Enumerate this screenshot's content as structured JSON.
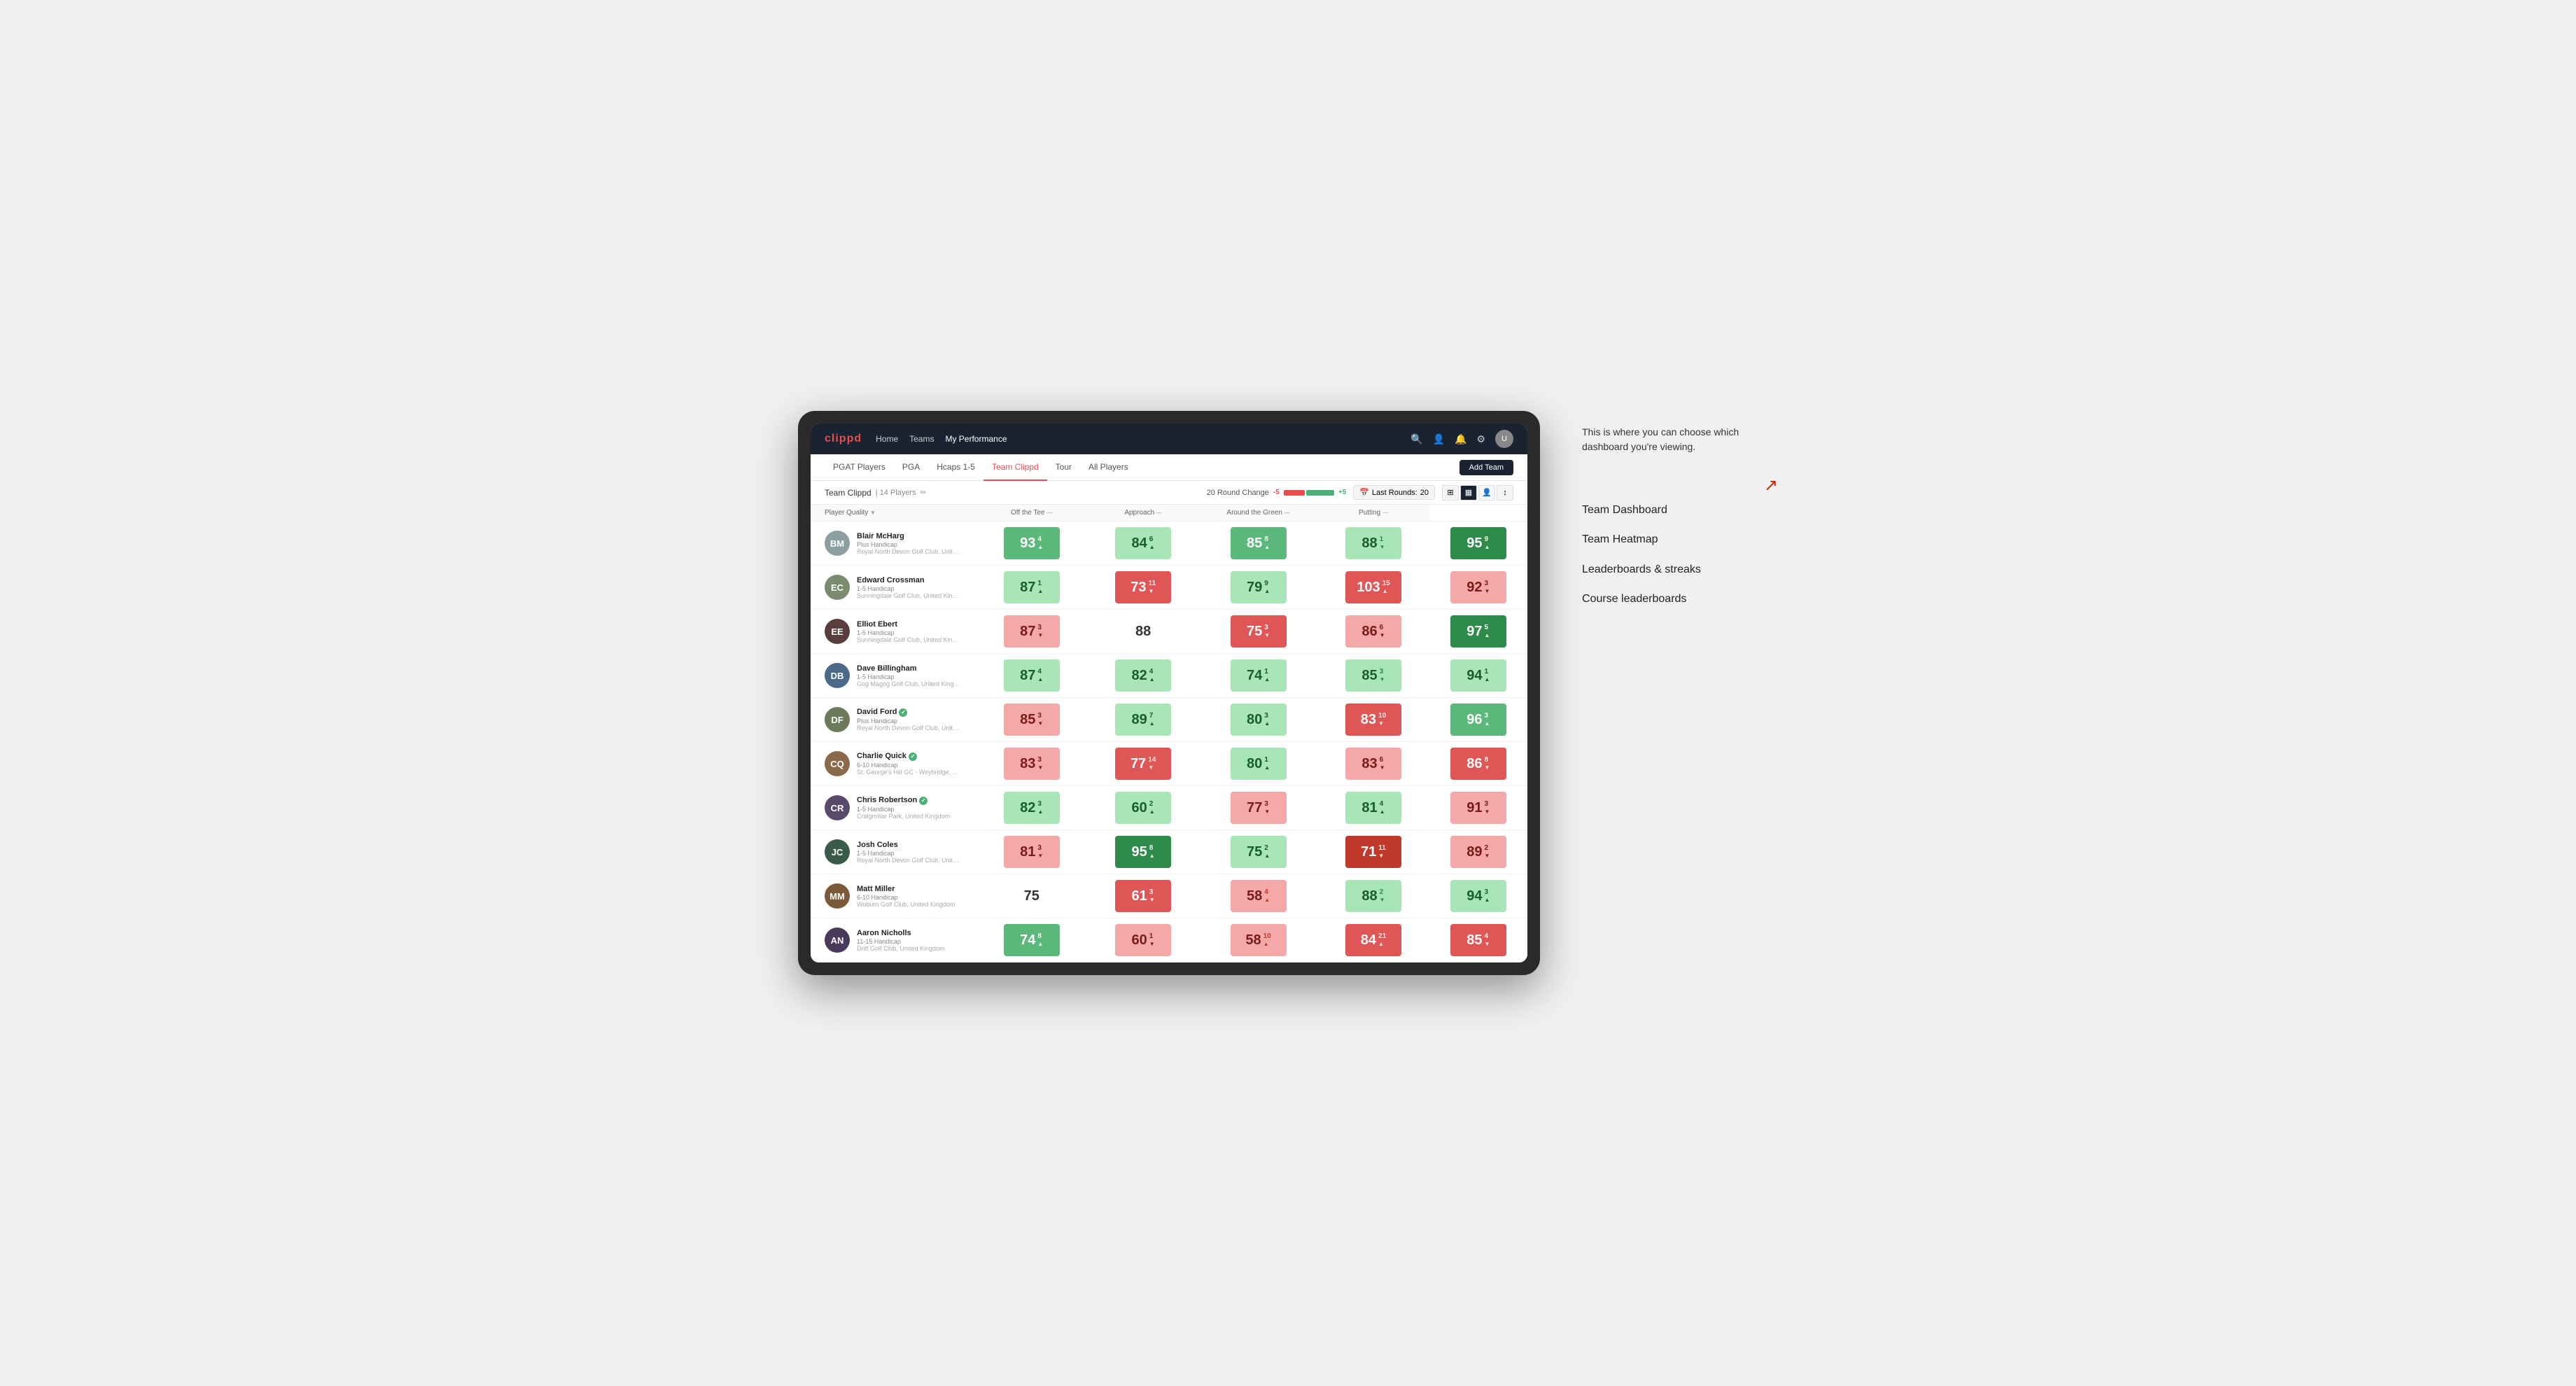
{
  "annotation": {
    "intro": "This is where you can choose which dashboard you're viewing.",
    "items": [
      "Team Dashboard",
      "Team Heatmap",
      "Leaderboards & streaks",
      "Course leaderboards"
    ]
  },
  "nav": {
    "logo": "clippd",
    "links": [
      "Home",
      "Teams",
      "My Performance"
    ],
    "activeLink": "My Performance"
  },
  "subNav": {
    "items": [
      "PGAT Players",
      "PGA",
      "Hcaps 1-5",
      "Team Clippd",
      "Tour",
      "All Players"
    ],
    "activeItem": "Team Clippd",
    "addTeamLabel": "Add Team"
  },
  "teamHeader": {
    "teamName": "Team Clippd",
    "playerCount": "14 Players",
    "roundChangeLabel": "20 Round Change",
    "roundChangeNeg": "-5",
    "roundChangePos": "+5",
    "lastRoundsLabel": "Last Rounds:",
    "lastRoundsNum": "20"
  },
  "tableHeaders": {
    "playerQuality": "Player Quality",
    "offTee": "Off the Tee",
    "approach": "Approach",
    "aroundGreen": "Around the Green",
    "putting": "Putting"
  },
  "players": [
    {
      "name": "Blair McHarg",
      "handicap": "Plus Handicap",
      "club": "Royal North Devon Golf Club, United Kingdom",
      "initials": "BM",
      "avatarColor": "#8B9EA0",
      "scores": [
        {
          "value": 93,
          "change": "4",
          "dir": "up",
          "color": "green-mid"
        },
        {
          "value": 84,
          "change": "6",
          "dir": "up",
          "color": "green-light"
        },
        {
          "value": 85,
          "change": "8",
          "dir": "up",
          "color": "green-mid"
        },
        {
          "value": 88,
          "change": "1",
          "dir": "down",
          "color": "green-light"
        },
        {
          "value": 95,
          "change": "9",
          "dir": "up",
          "color": "green-dark"
        }
      ]
    },
    {
      "name": "Edward Crossman",
      "handicap": "1-5 Handicap",
      "club": "Sunningdale Golf Club, United Kingdom",
      "initials": "EC",
      "avatarColor": "#7a8c6e",
      "scores": [
        {
          "value": 87,
          "change": "1",
          "dir": "up",
          "color": "green-light"
        },
        {
          "value": 73,
          "change": "11",
          "dir": "down",
          "color": "red-mid"
        },
        {
          "value": 79,
          "change": "9",
          "dir": "up",
          "color": "green-light"
        },
        {
          "value": 103,
          "change": "15",
          "dir": "up",
          "color": "red-mid"
        },
        {
          "value": 92,
          "change": "3",
          "dir": "down",
          "color": "red-light"
        }
      ]
    },
    {
      "name": "Elliot Ebert",
      "handicap": "1-5 Handicap",
      "club": "Sunningdale Golf Club, United Kingdom",
      "initials": "EE",
      "avatarColor": "#5a3e3e",
      "scores": [
        {
          "value": 87,
          "change": "3",
          "dir": "down",
          "color": "red-light"
        },
        {
          "value": 88,
          "change": "",
          "dir": "none",
          "color": "neutral"
        },
        {
          "value": 75,
          "change": "3",
          "dir": "down",
          "color": "red-mid"
        },
        {
          "value": 86,
          "change": "6",
          "dir": "down",
          "color": "red-light"
        },
        {
          "value": 97,
          "change": "5",
          "dir": "up",
          "color": "green-dark"
        }
      ]
    },
    {
      "name": "Dave Billingham",
      "handicap": "1-5 Handicap",
      "club": "Gog Magog Golf Club, United Kingdom",
      "initials": "DB",
      "avatarColor": "#4a6a8a",
      "scores": [
        {
          "value": 87,
          "change": "4",
          "dir": "up",
          "color": "green-light"
        },
        {
          "value": 82,
          "change": "4",
          "dir": "up",
          "color": "green-light"
        },
        {
          "value": 74,
          "change": "1",
          "dir": "up",
          "color": "green-light"
        },
        {
          "value": 85,
          "change": "3",
          "dir": "down",
          "color": "green-light"
        },
        {
          "value": 94,
          "change": "1",
          "dir": "up",
          "color": "green-light"
        }
      ]
    },
    {
      "name": "David Ford",
      "handicap": "Plus Handicap",
      "club": "Royal North Devon Golf Club, United Kingdom",
      "initials": "DF",
      "avatarColor": "#6a7a5a",
      "verified": true,
      "scores": [
        {
          "value": 85,
          "change": "3",
          "dir": "down",
          "color": "red-light"
        },
        {
          "value": 89,
          "change": "7",
          "dir": "up",
          "color": "green-light"
        },
        {
          "value": 80,
          "change": "3",
          "dir": "up",
          "color": "green-light"
        },
        {
          "value": 83,
          "change": "10",
          "dir": "down",
          "color": "red-mid"
        },
        {
          "value": 96,
          "change": "3",
          "dir": "up",
          "color": "green-mid"
        }
      ]
    },
    {
      "name": "Charlie Quick",
      "handicap": "6-10 Handicap",
      "club": "St. George's Hill GC - Weybridge, Surrey, Uni...",
      "initials": "CQ",
      "avatarColor": "#8a6a4a",
      "verified": true,
      "scores": [
        {
          "value": 83,
          "change": "3",
          "dir": "down",
          "color": "red-light"
        },
        {
          "value": 77,
          "change": "14",
          "dir": "down",
          "color": "red-mid"
        },
        {
          "value": 80,
          "change": "1",
          "dir": "up",
          "color": "green-light"
        },
        {
          "value": 83,
          "change": "6",
          "dir": "down",
          "color": "red-light"
        },
        {
          "value": 86,
          "change": "8",
          "dir": "down",
          "color": "red-mid"
        }
      ]
    },
    {
      "name": "Chris Robertson",
      "handicap": "1-5 Handicap",
      "club": "Craigmillar Park, United Kingdom",
      "initials": "CR",
      "avatarColor": "#5a4a6a",
      "verified": true,
      "scores": [
        {
          "value": 82,
          "change": "3",
          "dir": "up",
          "color": "green-light"
        },
        {
          "value": 60,
          "change": "2",
          "dir": "up",
          "color": "green-light"
        },
        {
          "value": 77,
          "change": "3",
          "dir": "down",
          "color": "red-light"
        },
        {
          "value": 81,
          "change": "4",
          "dir": "up",
          "color": "green-light"
        },
        {
          "value": 91,
          "change": "3",
          "dir": "down",
          "color": "red-light"
        }
      ]
    },
    {
      "name": "Josh Coles",
      "handicap": "1-5 Handicap",
      "club": "Royal North Devon Golf Club, United Kingdom",
      "initials": "JC",
      "avatarColor": "#3a5a4a",
      "scores": [
        {
          "value": 81,
          "change": "3",
          "dir": "down",
          "color": "red-light"
        },
        {
          "value": 95,
          "change": "8",
          "dir": "up",
          "color": "green-dark"
        },
        {
          "value": 75,
          "change": "2",
          "dir": "up",
          "color": "green-light"
        },
        {
          "value": 71,
          "change": "11",
          "dir": "down",
          "color": "red-dark"
        },
        {
          "value": 89,
          "change": "2",
          "dir": "down",
          "color": "red-light"
        }
      ]
    },
    {
      "name": "Matt Miller",
      "handicap": "6-10 Handicap",
      "club": "Woburn Golf Club, United Kingdom",
      "initials": "MM",
      "avatarColor": "#7a5a3a",
      "scores": [
        {
          "value": 75,
          "change": "",
          "dir": "none",
          "color": "neutral"
        },
        {
          "value": 61,
          "change": "3",
          "dir": "down",
          "color": "red-mid"
        },
        {
          "value": 58,
          "change": "4",
          "dir": "up",
          "color": "red-light"
        },
        {
          "value": 88,
          "change": "2",
          "dir": "down",
          "color": "green-light"
        },
        {
          "value": 94,
          "change": "3",
          "dir": "up",
          "color": "green-light"
        }
      ]
    },
    {
      "name": "Aaron Nicholls",
      "handicap": "11-15 Handicap",
      "club": "Drift Golf Club, United Kingdom",
      "initials": "AN",
      "avatarColor": "#4a3a5a",
      "scores": [
        {
          "value": 74,
          "change": "8",
          "dir": "up",
          "color": "green-mid"
        },
        {
          "value": 60,
          "change": "1",
          "dir": "down",
          "color": "red-light"
        },
        {
          "value": 58,
          "change": "10",
          "dir": "up",
          "color": "red-light"
        },
        {
          "value": 84,
          "change": "21",
          "dir": "up",
          "color": "red-mid"
        },
        {
          "value": 85,
          "change": "4",
          "dir": "down",
          "color": "red-mid"
        }
      ]
    }
  ]
}
